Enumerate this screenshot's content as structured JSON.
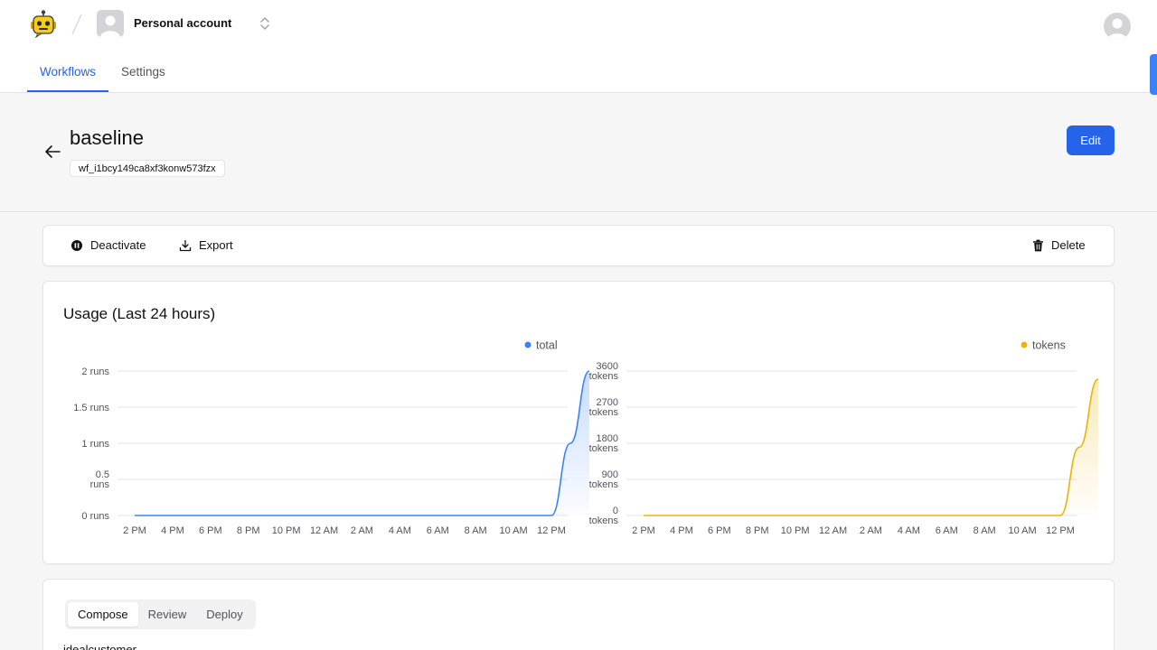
{
  "header": {
    "account_name": "Personal account",
    "tabs": [
      {
        "label": "Workflows",
        "active": true
      },
      {
        "label": "Settings",
        "active": false
      }
    ]
  },
  "workflow": {
    "title": "baseline",
    "id": "wf_i1bcy149ca8xf3konw573fzx",
    "edit_label": "Edit"
  },
  "actions": {
    "deactivate": "Deactivate",
    "export": "Export",
    "delete": "Delete"
  },
  "usage": {
    "title": "Usage (Last 24 hours)"
  },
  "chart_data": [
    {
      "type": "area",
      "title": "",
      "series": [
        {
          "name": "total",
          "color": "#3b82f6",
          "values": [
            0,
            0,
            0,
            0,
            0,
            0,
            0,
            0,
            0,
            0,
            0,
            0,
            0,
            0,
            0,
            0,
            0,
            0,
            0,
            0,
            0,
            0,
            0,
            1,
            2
          ]
        }
      ],
      "x_ticks": [
        "2 PM",
        "4 PM",
        "6 PM",
        "8 PM",
        "10 PM",
        "12 AM",
        "2 AM",
        "4 AM",
        "6 AM",
        "8 AM",
        "10 AM",
        "12 PM"
      ],
      "y_ticks": [
        {
          "value": 0,
          "line1": "0 runs",
          "line2": ""
        },
        {
          "value": 0.5,
          "line1": "0.5",
          "line2": "runs"
        },
        {
          "value": 1,
          "line1": "1 runs",
          "line2": ""
        },
        {
          "value": 1.5,
          "line1": "1.5 runs",
          "line2": ""
        },
        {
          "value": 2,
          "line1": "2 runs",
          "line2": ""
        }
      ],
      "ylim": [
        0,
        2
      ],
      "legend_position": "top-right",
      "grid": true
    },
    {
      "type": "area",
      "title": "",
      "series": [
        {
          "name": "tokens",
          "color": "#eab308",
          "values": [
            0,
            0,
            0,
            0,
            0,
            0,
            0,
            0,
            0,
            0,
            0,
            0,
            0,
            0,
            0,
            0,
            0,
            0,
            0,
            0,
            0,
            0,
            0,
            1700,
            3400
          ]
        }
      ],
      "x_ticks": [
        "2 PM",
        "4 PM",
        "6 PM",
        "8 PM",
        "10 PM",
        "12 AM",
        "2 AM",
        "4 AM",
        "6 AM",
        "8 AM",
        "10 AM",
        "12 PM"
      ],
      "y_ticks": [
        {
          "value": 0,
          "line1": "0",
          "line2": "tokens"
        },
        {
          "value": 900,
          "line1": "900",
          "line2": "tokens"
        },
        {
          "value": 1800,
          "line1": "1800",
          "line2": "tokens"
        },
        {
          "value": 2700,
          "line1": "2700",
          "line2": "tokens"
        },
        {
          "value": 3600,
          "line1": "3600",
          "line2": "tokens"
        }
      ],
      "ylim": [
        0,
        3600
      ],
      "legend_position": "top-right",
      "grid": true
    }
  ],
  "editor": {
    "tabs": [
      {
        "label": "Compose",
        "active": true
      },
      {
        "label": "Review",
        "active": false
      },
      {
        "label": "Deploy",
        "active": false
      }
    ],
    "field_label": "idealcustomer"
  }
}
